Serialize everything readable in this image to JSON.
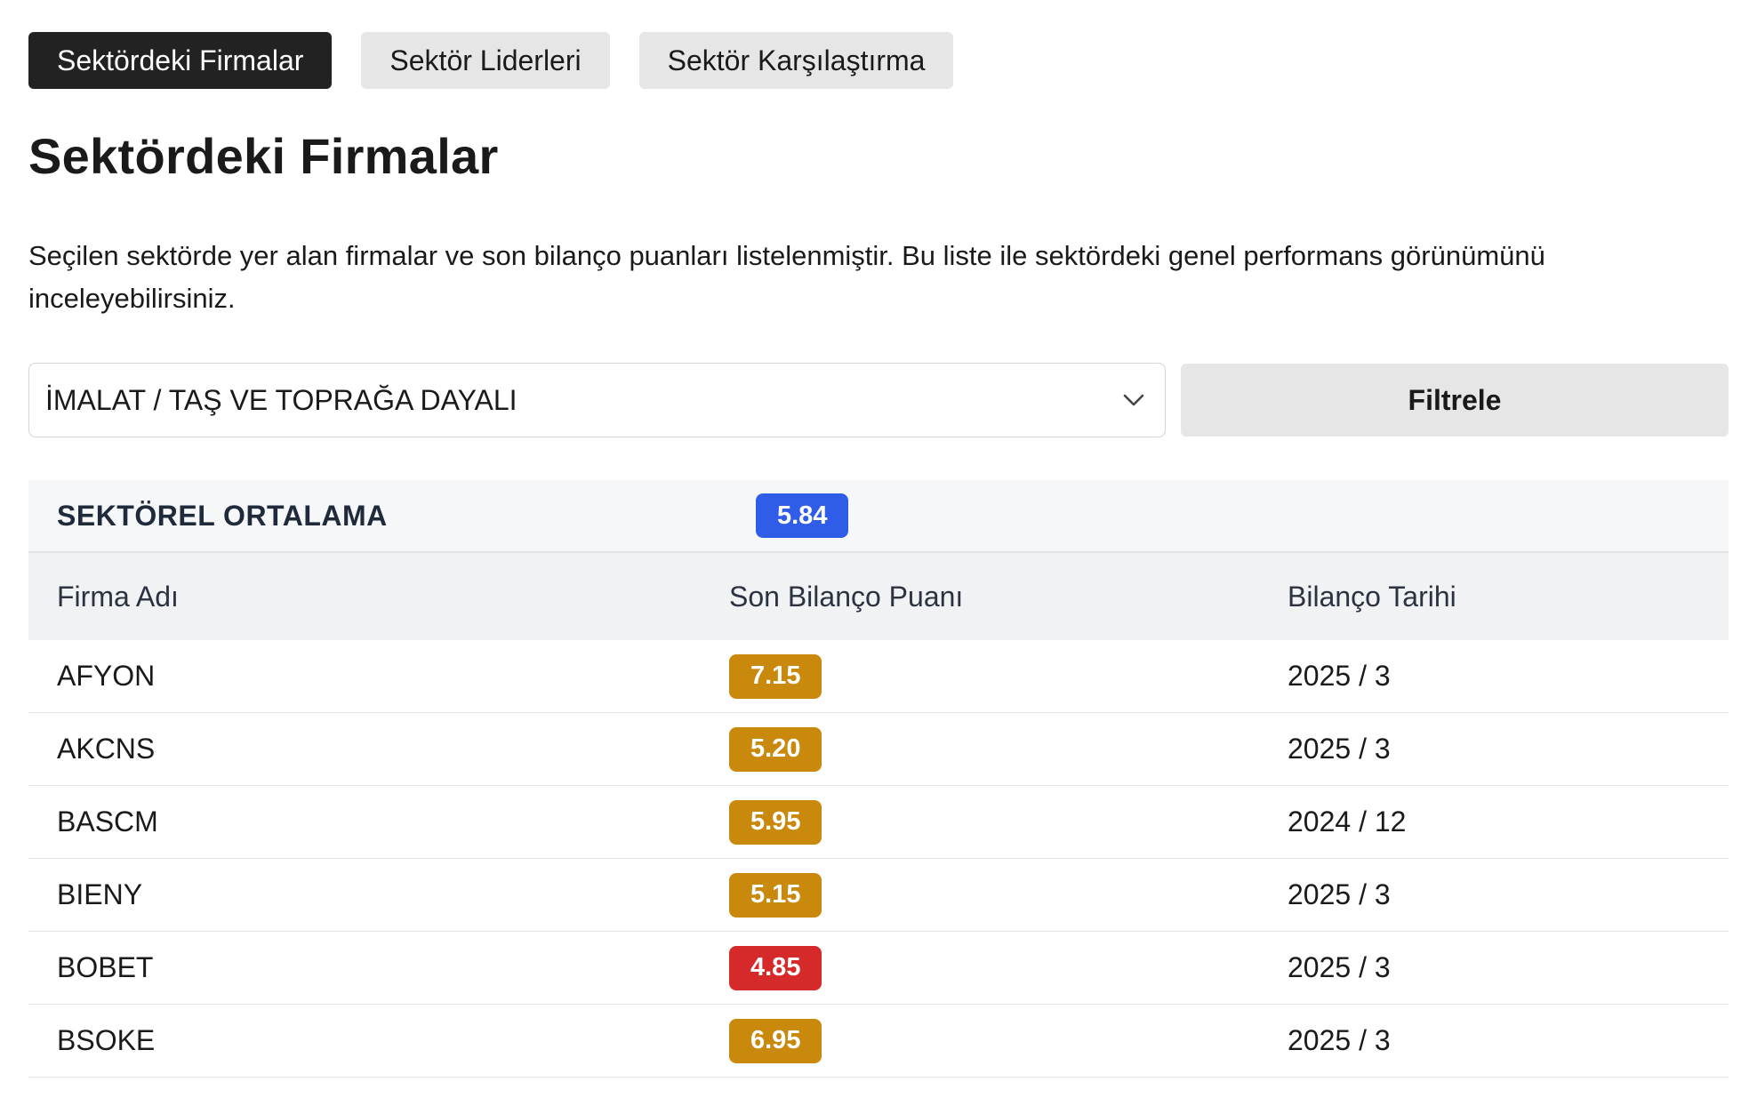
{
  "tabs": [
    {
      "label": "Sektördeki Firmalar",
      "active": true
    },
    {
      "label": "Sektör Liderleri",
      "active": false
    },
    {
      "label": "Sektör Karşılaştırma",
      "active": false
    }
  ],
  "page_title": "Sektördeki Firmalar",
  "description": "Seçilen sektörde yer alan firmalar ve son bilanço puanları listelenmiştir. Bu liste ile sektördeki genel performans görünümünü inceleyebilirsiniz.",
  "filter": {
    "selected_sector": "İMALAT / TAŞ VE TOPRAĞA DAYALI",
    "button_label": "Filtrele"
  },
  "table": {
    "average_label": "SEKTÖREL ORTALAMA",
    "average_value": "5.84",
    "columns": [
      "Firma Adı",
      "Son Bilanço Puanı",
      "Bilanço Tarihi"
    ],
    "rows": [
      {
        "name": "AFYON",
        "score": "7.15",
        "level": "amber",
        "date": "2025 / 3"
      },
      {
        "name": "AKCNS",
        "score": "5.20",
        "level": "amber",
        "date": "2025 / 3"
      },
      {
        "name": "BASCM",
        "score": "5.95",
        "level": "amber",
        "date": "2024 / 12"
      },
      {
        "name": "BIENY",
        "score": "5.15",
        "level": "amber",
        "date": "2025 / 3"
      },
      {
        "name": "BOBET",
        "score": "4.85",
        "level": "red",
        "date": "2025 / 3"
      },
      {
        "name": "BSOKE",
        "score": "6.95",
        "level": "amber",
        "date": "2025 / 3"
      }
    ]
  },
  "colors": {
    "average_badge": "#2f5de8",
    "amber_badge": "#c8890c",
    "red_badge": "#d62a2a",
    "active_tab": "#222222"
  },
  "icons": {
    "select_chevron": "chevron-down-icon"
  }
}
